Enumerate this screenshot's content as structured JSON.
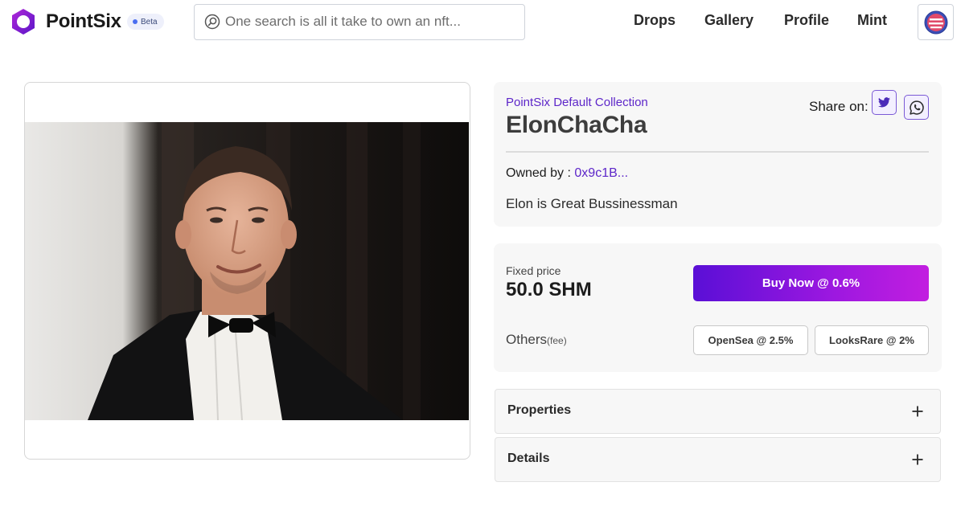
{
  "header": {
    "brand": "PointSix",
    "beta_label": "Beta",
    "search": {
      "placeholder": "One search is all it take to own an nft..."
    },
    "nav": [
      "Drops",
      "Gallery",
      "Profile",
      "Mint"
    ]
  },
  "nft": {
    "collection": "PointSix Default Collection",
    "title": "ElonChaCha",
    "share_label": "Share on:",
    "owned_by_label": "Owned by :",
    "owner_address": "0x9c1B...",
    "description": "Elon is Great Bussinessman"
  },
  "pricing": {
    "fixed_label": "Fixed price",
    "price": "50.0 SHM",
    "buy_label": "Buy Now @ 0.6%",
    "others_label": "Others",
    "fee_label": "(fee)",
    "opensea_label": "OpenSea @ 2.5%",
    "looksrare_label": "LooksRare @ 2%"
  },
  "accordions": {
    "properties": "Properties",
    "details": "Details"
  },
  "colors": {
    "accent_purple": "#5d26c9",
    "buy_gradient_start": "#5a0fd6",
    "buy_gradient_end": "#c21ee0",
    "card_bg": "#f7f7f7"
  },
  "icons": {
    "logo": "pointsix-ring-logo",
    "search": "search-icon",
    "avatar": "avatar-icon",
    "twitter": "twitter-icon",
    "whatsapp": "whatsapp-icon",
    "expand": "plus-icon"
  }
}
